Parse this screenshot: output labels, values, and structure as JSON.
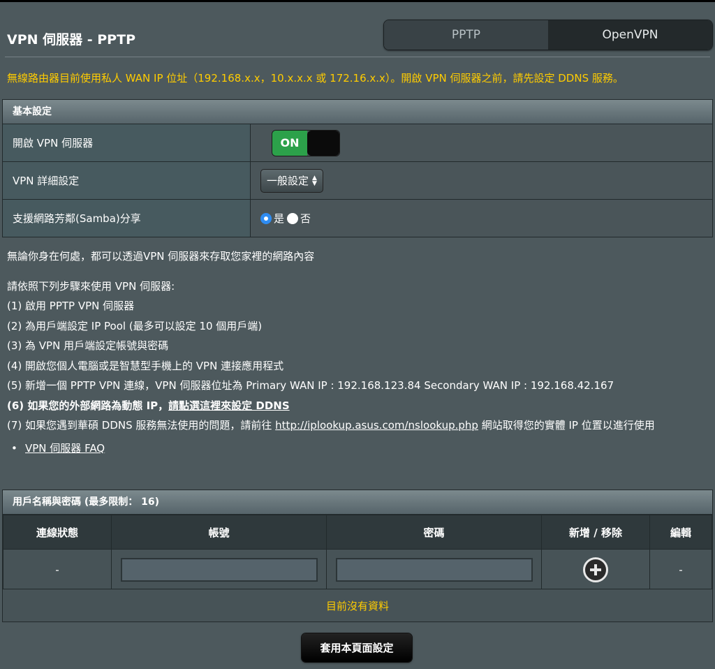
{
  "header": {
    "title": "VPN 伺服器 - PPTP",
    "tabs": [
      {
        "label": "PPTP",
        "active": true
      },
      {
        "label": "OpenVPN",
        "active": false
      }
    ]
  },
  "warning": "無線路由器目前使用私人 WAN IP 位址（192.168.x.x，10.x.x.x 或 172.16.x.x）。開啟 VPN 伺服器之前，請先設定 DDNS 服務。",
  "basic": {
    "header": "基本設定",
    "enable_label": "開啟 VPN 伺服器",
    "toggle_on": "ON",
    "detail_label": "VPN 詳細設定",
    "detail_value": "一般設定",
    "samba_label": "支援網路芳鄰(Samba)分享",
    "samba_yes": "是",
    "samba_no": "否"
  },
  "info": {
    "intro": "無論你身在何處，都可以透過VPN 伺服器來存取您家裡的網路內容",
    "steps_title": "請依照下列步驟來使用 VPN 伺服器:",
    "step1": "(1) 啟用 PPTP VPN 伺服器",
    "step2": "(2) 為用戶端設定 IP Pool (最多可以設定 10 個用戶端)",
    "step3": "(3) 為 VPN 用戶端設定帳號與密碼",
    "step4": "(4) 開啟您個人電腦或是智慧型手機上的 VPN 連接應用程式",
    "step5": "(5) 新增一個 PPTP VPN 連線，VPN 伺服器位址為  Primary WAN IP : 192.168.123.84  Secondary WAN IP : 192.168.42.167",
    "step6_prefix": "(6) 如果您的外部網路為動態 IP，",
    "step6_link": "請點選這裡來設定 DDNS",
    "step7_prefix": "(7) 如果您遇到華碩 DDNS 服務無法使用的問題，請前往 ",
    "step7_link": "http://iplookup.asus.com/nslookup.php",
    "step7_suffix": " 網站取得您的實體 IP 位置以進行使用",
    "faq_link": "VPN 伺服器 FAQ"
  },
  "users": {
    "header": "用戶名稱與密碼 (最多限制： 16)",
    "columns": [
      "連線狀態",
      "帳號",
      "密碼",
      "新增 / 移除",
      "編輯"
    ],
    "row_status": "-",
    "row_edit": "-",
    "empty_text": "目前沒有資料"
  },
  "apply_button": "套用本頁面設定",
  "colors": {
    "background": "#4d595d",
    "warning": "#ffcc00",
    "toggle_on": "#2ca14a",
    "radio_checked": "#2e8cf2"
  }
}
